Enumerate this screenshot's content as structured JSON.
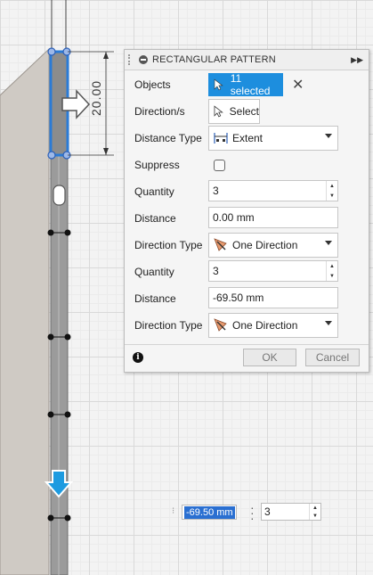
{
  "canvas": {
    "dimension_value": "20.00",
    "distance_input_value": "-69.50 mm",
    "quantity_input_value": "3"
  },
  "panel": {
    "title": "RECTANGULAR PATTERN",
    "objects_label": "Objects",
    "objects_value": "11 selected",
    "directions_label": "Direction/s",
    "directions_button": "Select",
    "distance_type_label": "Distance Type",
    "distance_type_value": "Extent",
    "suppress_label": "Suppress",
    "quantity1_label": "Quantity",
    "quantity1_value": "3",
    "distance1_label": "Distance",
    "distance1_value": "0.00 mm",
    "direction_type1_label": "Direction Type",
    "direction_type1_value": "One Direction",
    "quantity2_label": "Quantity",
    "quantity2_value": "3",
    "distance2_label": "Distance",
    "distance2_value": "-69.50 mm",
    "direction_type2_label": "Direction Type",
    "direction_type2_value": "One Direction",
    "ok_label": "OK",
    "cancel_label": "Cancel"
  },
  "colors": {
    "accent": "#1d8ede",
    "selection_blue": "#2a6fd1",
    "body_gray": "#cfcac4"
  },
  "icons": [
    "minus-icon",
    "fast-forward-icon",
    "cursor-icon",
    "close-icon",
    "extent-icon",
    "direction-icon",
    "info-icon",
    "arrow-right-icon",
    "arrow-down-icon"
  ]
}
